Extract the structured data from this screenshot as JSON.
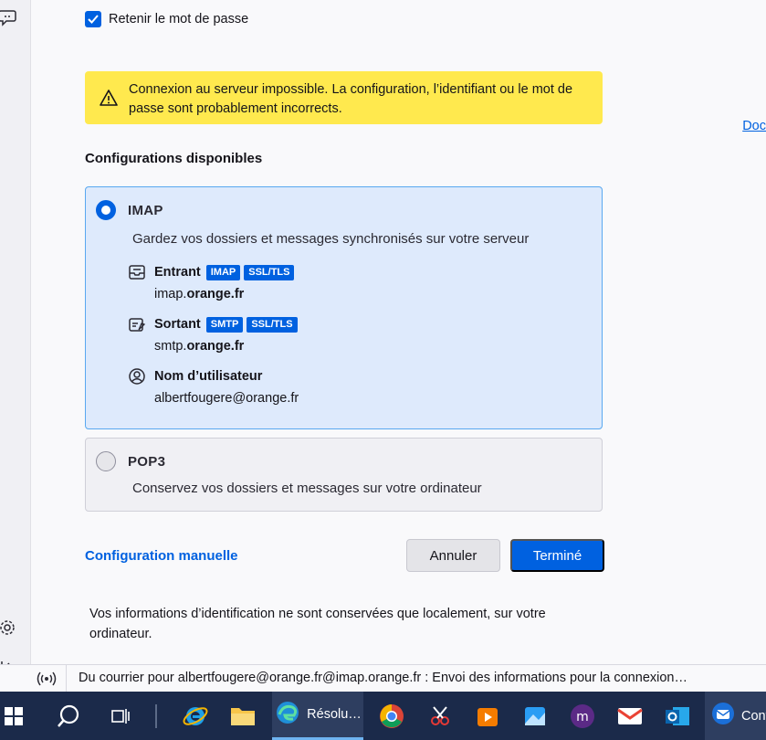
{
  "form": {
    "remember_password_label": "Retenir le mot de passe",
    "remember_password_checked": true
  },
  "warning": {
    "message": "Connexion au serveur impossible. La configuration, l’identifiant ou le mot de passe sont probablement incorrects."
  },
  "doc_link": "Doc",
  "configs": {
    "title": "Configurations disponibles",
    "imap": {
      "name": "IMAP",
      "description": "Gardez vos dossiers et messages synchronisés sur votre serveur",
      "incoming": {
        "label": "Entrant",
        "badges": [
          "IMAP",
          "SSL/TLS"
        ],
        "host_prefix": "imap.",
        "host_domain": "orange.fr"
      },
      "outgoing": {
        "label": "Sortant",
        "badges": [
          "SMTP",
          "SSL/TLS"
        ],
        "host_prefix": "smtp.",
        "host_domain": "orange.fr"
      },
      "username": {
        "label": "Nom d’utilisateur",
        "value": "albertfougere@orange.fr"
      },
      "selected": true
    },
    "pop3": {
      "name": "POP3",
      "description": "Conservez vos dossiers et messages sur votre ordinateur",
      "selected": false
    }
  },
  "actions": {
    "manual_config": "Configuration manuelle",
    "cancel": "Annuler",
    "done": "Terminé"
  },
  "info_text": "Vos informations d’identification ne sont conservées que localement, sur votre ordinateur.",
  "status_bar": {
    "text": "Du courrier pour albertfougere@orange.fr@imap.orange.fr : Envoi des informations pour la connexion…"
  },
  "taskbar": {
    "active_app_label": "Résolu…",
    "last_app_label": "Cont"
  },
  "colors": {
    "accent": "#0061e0",
    "warning_bg": "#ffe94e",
    "selected_card_bg": "#deeafc",
    "taskbar_bg": "#1b2a4a"
  }
}
